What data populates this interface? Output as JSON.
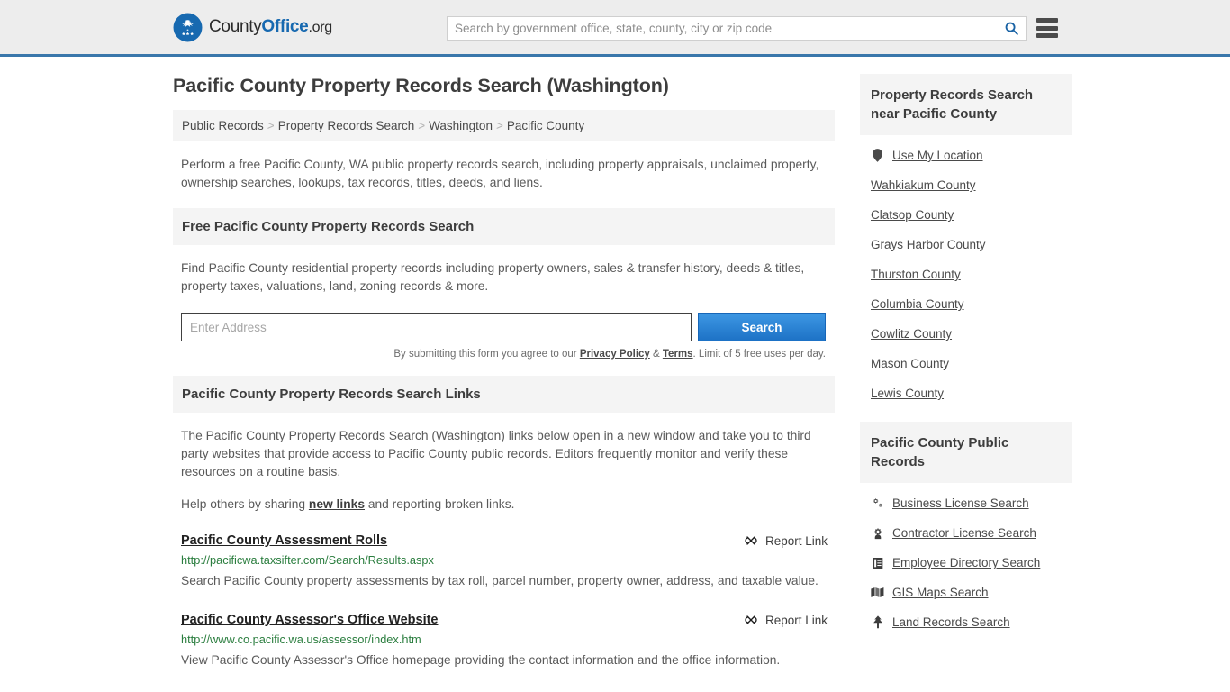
{
  "header": {
    "logo": {
      "part1": "County",
      "part2": "Office",
      "part3": ".org",
      "emblem_icon": "eagle-seal-icon"
    },
    "search": {
      "placeholder": "Search by government office, state, county, city or zip code",
      "value": "",
      "icon": "search-icon"
    },
    "menu_icon": "hamburger-menu-icon",
    "accent_color": "#3a77ab"
  },
  "main": {
    "title": "Pacific County Property Records Search (Washington)",
    "breadcrumb": [
      "Public Records",
      "Property Records Search",
      "Washington",
      "Pacific County"
    ],
    "breadcrumb_separator": ">",
    "intro": "Perform a free Pacific County, WA public property records search, including property appraisals, unclaimed property, ownership searches, lookups, tax records, titles, deeds, and liens.",
    "free_search": {
      "heading": "Free Pacific County Property Records Search",
      "description": "Find Pacific County residential property records including property owners, sales & transfer history, deeds & titles, property taxes, valuations, land, zoning records & more.",
      "address_placeholder": "Enter Address",
      "address_value": "",
      "search_button": "Search",
      "disclaimer_prefix": "By submitting this form you agree to our ",
      "privacy_policy": "Privacy Policy",
      "disclaimer_amp": " & ",
      "terms": "Terms",
      "disclaimer_suffix": ". Limit of 5 free uses per day.",
      "button_color": "#2179cd"
    },
    "links_section": {
      "heading": "Pacific County Property Records Search Links",
      "paragraph": "The Pacific County Property Records Search (Washington) links below open in a new window and take you to third party websites that provide access to Pacific County public records. Editors frequently monitor and verify these resources on a routine basis.",
      "share_prefix": "Help others by sharing ",
      "share_link": "new links",
      "share_suffix": " and reporting broken links.",
      "report_label": "Report Link",
      "report_icon": "broken-link-icon"
    },
    "resources": [
      {
        "title": "Pacific County Assessment Rolls",
        "url": "http://pacificwa.taxsifter.com/Search/Results.aspx",
        "description": "Search Pacific County property assessments by tax roll, parcel number, property owner, address, and taxable value."
      },
      {
        "title": "Pacific County Assessor's Office Website",
        "url": "http://www.co.pacific.wa.us/assessor/index.htm",
        "description": "View Pacific County Assessor's Office homepage providing the contact information and the office information."
      }
    ]
  },
  "sidebar": {
    "nearby": {
      "heading": "Property Records Search near Pacific County",
      "items": [
        {
          "label": "Use My Location",
          "icon": "map-pin-icon"
        },
        {
          "label": "Wahkiakum County",
          "icon": ""
        },
        {
          "label": "Clatsop County",
          "icon": ""
        },
        {
          "label": "Grays Harbor County",
          "icon": ""
        },
        {
          "label": "Thurston County",
          "icon": ""
        },
        {
          "label": "Columbia County",
          "icon": ""
        },
        {
          "label": "Cowlitz County",
          "icon": ""
        },
        {
          "label": "Mason County",
          "icon": ""
        },
        {
          "label": "Lewis County",
          "icon": ""
        }
      ]
    },
    "public_records": {
      "heading": "Pacific County Public Records",
      "items": [
        {
          "label": "Business License Search",
          "icon": "cogs-icon"
        },
        {
          "label": "Contractor License Search",
          "icon": "cog-icon"
        },
        {
          "label": "Employee Directory Search",
          "icon": "book-icon"
        },
        {
          "label": "GIS Maps Search",
          "icon": "map-icon"
        },
        {
          "label": "Land Records Search",
          "icon": "tree-icon"
        }
      ]
    }
  }
}
